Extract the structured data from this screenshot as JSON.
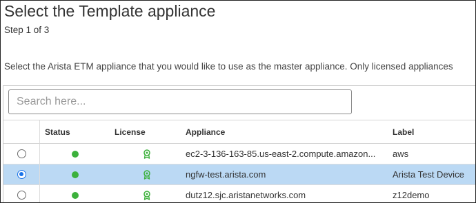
{
  "page": {
    "title": "Select the Template appliance",
    "step": "Step 1 of 3",
    "instructions": "Select the Arista ETM appliance that you would like to use as the master appliance. Only licensed appliances"
  },
  "search": {
    "placeholder": "Search here...",
    "value": ""
  },
  "table": {
    "columns": {
      "status": "Status",
      "license": "License",
      "appliance": "Appliance",
      "label": "Label"
    },
    "rows": [
      {
        "selected": false,
        "status": "online",
        "license": "licensed",
        "appliance": "ec2-3-136-163-85.us-east-2.compute.amazon...",
        "label": "aws"
      },
      {
        "selected": true,
        "status": "online",
        "license": "licensed",
        "appliance": "ngfw-test.arista.com",
        "label": "Arista Test Device"
      },
      {
        "selected": false,
        "status": "online",
        "license": "licensed",
        "appliance": "dutz12.sjc.aristanetworks.com",
        "label": "z12demo"
      }
    ]
  },
  "icons": {
    "status": "green-status-dot",
    "license": "license-ribbon-icon",
    "radio": "radio-button"
  },
  "colors": {
    "selected_row": "#bbd9f4",
    "status_online": "#3cb13c",
    "license_icon": "#3cb13c",
    "radio_checked": "#1a73e8"
  }
}
